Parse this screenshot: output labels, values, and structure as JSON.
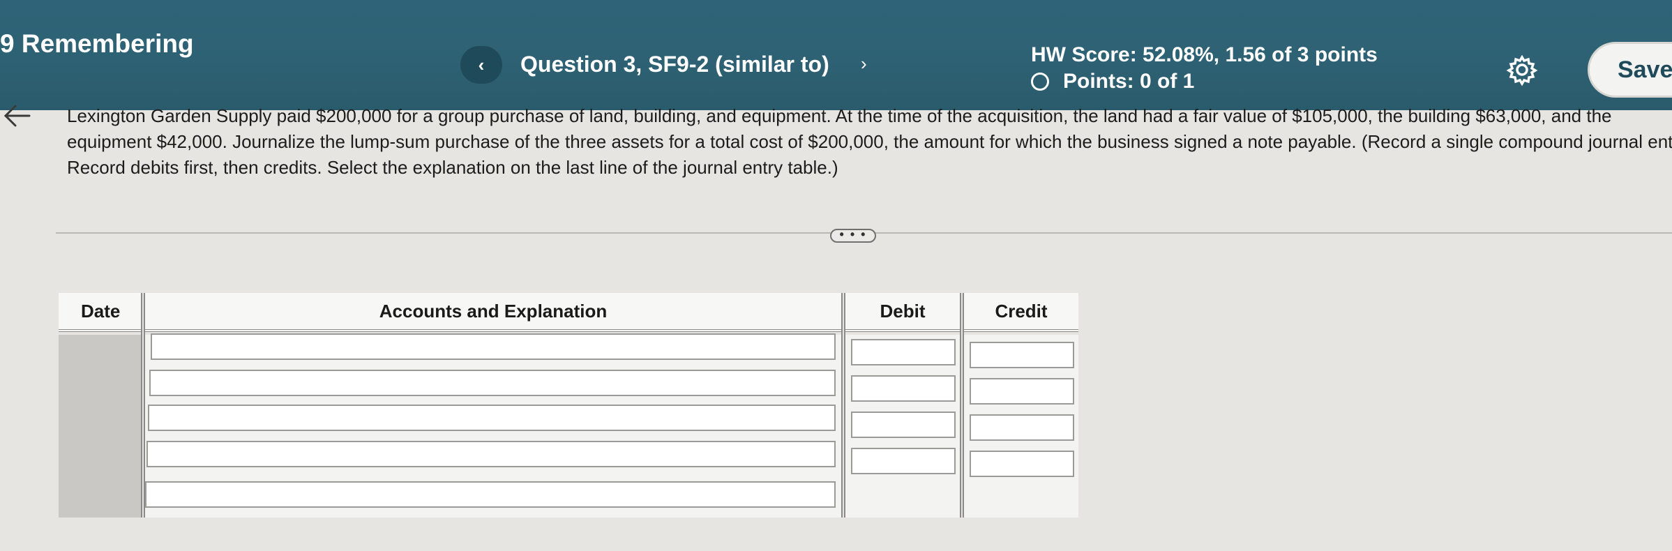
{
  "header": {
    "assignment_title": "9 Remembering",
    "prev_label": "‹",
    "question_title": "Question 3, SF9-2 (similar to)",
    "next_label": "›",
    "hw_score": "HW Score: 52.08%, 1.56 of 3 points",
    "points": "Points: 0 of 1",
    "save_label": "Save"
  },
  "problem": {
    "text": "Lexington Garden Supply paid $200,000 for a group purchase of land, building, and equipment. At the time of the acquisition, the land had a fair value of $105,000, the building $63,000, and the equipment $42,000. Journalize the lump-sum purchase of the three assets for a total cost of $200,000, the amount for which the business signed a note payable. (Record a single compound journal entry. Record debits first, then credits. Select the explanation on the last line of the journal entry table.)"
  },
  "more_label": "• • •",
  "journal": {
    "headers": {
      "date": "Date",
      "accounts": "Accounts and Explanation",
      "debit": "Debit",
      "credit": "Credit"
    },
    "rows": [
      {
        "account": "",
        "debit": "",
        "credit": ""
      },
      {
        "account": "",
        "debit": "",
        "credit": ""
      },
      {
        "account": "",
        "debit": "",
        "credit": ""
      },
      {
        "account": "",
        "debit": "",
        "credit": ""
      },
      {
        "account": ""
      }
    ]
  },
  "colors": {
    "header_bg": "#2d6173",
    "accent": "#1f4a59",
    "page_bg": "#e6e5e1"
  }
}
